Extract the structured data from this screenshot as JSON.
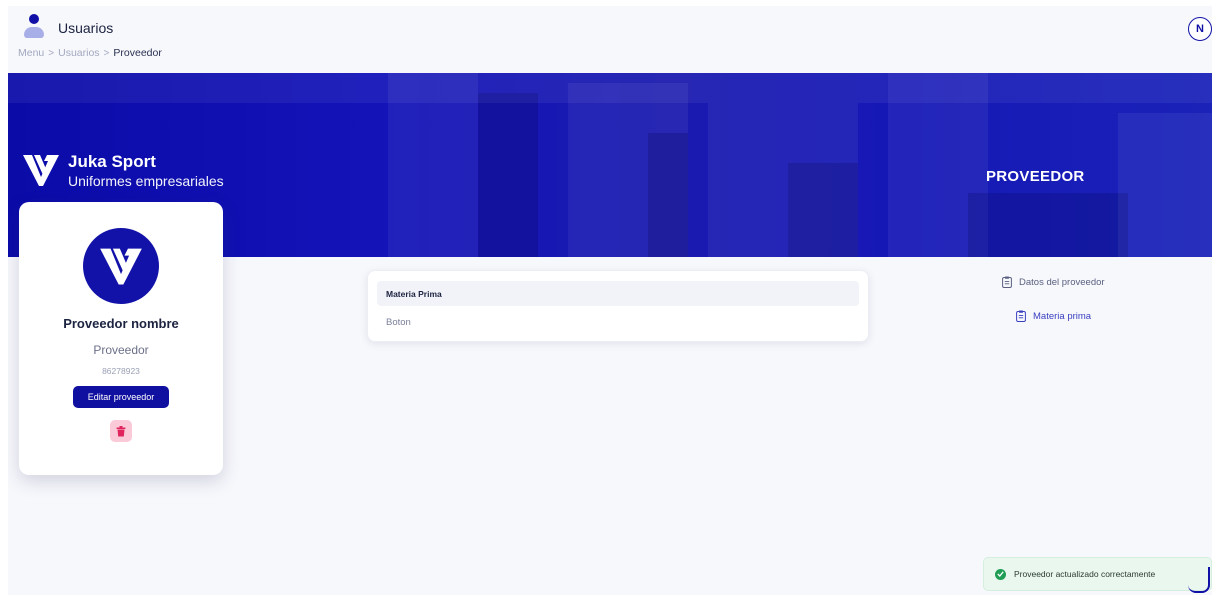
{
  "header": {
    "title": "Usuarios",
    "breadcrumb": {
      "items": [
        "Menu",
        "Usuarios"
      ],
      "separator": ">",
      "current": "Proveedor"
    },
    "avatar_initial": "N"
  },
  "banner": {
    "brand_name": "Juka Sport",
    "brand_subtitle": "Uniformes empresariales",
    "section_title": "PROVEEDOR"
  },
  "profile": {
    "name": "Proveedor nombre",
    "role": "Proveedor",
    "code": "86278923",
    "edit_label": "Editar proveedor",
    "delete_icon": "trash-icon"
  },
  "table": {
    "header": "Materia Prima",
    "rows": [
      "Boton"
    ]
  },
  "side_menu": {
    "items": [
      {
        "label": "Datos del proveedor",
        "icon": "clipboard-icon"
      },
      {
        "label": "Materia prima",
        "icon": "clipboard-icon"
      }
    ]
  },
  "toast": {
    "message": "Proveedor actualizado correctamente",
    "icon": "check-circle-icon"
  },
  "colors": {
    "primary": "#1010a6",
    "banner": "#1414b2",
    "delete_bg": "#fbcad8",
    "success": "#1f9d55"
  }
}
